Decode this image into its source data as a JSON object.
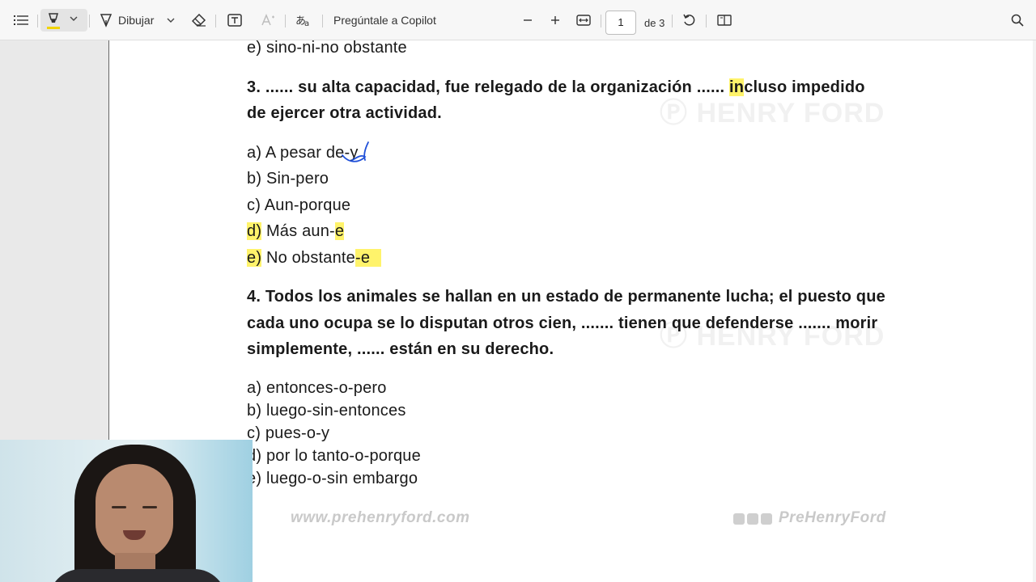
{
  "toolbar": {
    "draw_label": "Dibujar",
    "copilot_label": "Pregúntale a Copilot",
    "page_current": "1",
    "page_total": "de 3",
    "accent_highlight": "#f1d400"
  },
  "document": {
    "prev_option_e": "e) sino-ni-no obstante",
    "q3": {
      "line1_before": "3. ...... su alta capacidad, fue relegado de la organización ...... ",
      "line1_hl": "in",
      "line1_after": "cluso impedido",
      "line2": "de ejercer otra actividad.",
      "a": "a) A pesar de-y",
      "b": "b) Sin-pero",
      "c": "c) Aun-porque",
      "d_prefix": "d)",
      "d_mid": " Más aun-",
      "d_suffix": "e",
      "e_prefix": "e)",
      "e_mid": " No obstante",
      "e_suffix": "-e"
    },
    "q4": {
      "line1": "4. Todos los animales se hallan en un estado de permanente lucha; el puesto que",
      "line2": "cada uno ocupa se lo disputan otros cien, ....... tienen que defenderse ....... morir",
      "line3": "simplemente, ...... están en su derecho.",
      "a": "a) entonces-o-pero",
      "b": "b) luego-sin-entonces",
      "c": "c) pues-o-y",
      "d": "d) por lo tanto-o-porque",
      "e": "e) luego-o-sin embargo"
    },
    "watermark_left": "www.prehenryford.com",
    "watermark_right": "PreHenryFord",
    "highlight_color": "#fff36b",
    "ink_color": "#1f4fd8"
  }
}
